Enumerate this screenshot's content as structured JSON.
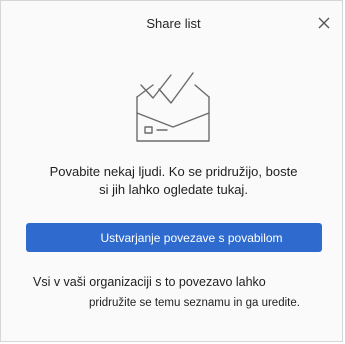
{
  "dialog": {
    "title": "Share list",
    "close_icon": "close-icon",
    "illustration_icon": "envelope-checkmark-icon",
    "message_line1": "Povabite nekaj ljudi. Ko se pridružijo, boste",
    "message_line2": "si jih lahko ogledate tukaj.",
    "primary_button_label": "Ustvarjanje povezave s povabilom",
    "info_line1": "Vsi v vaši organizaciji s to povezavo lahko",
    "info_line2": "pridružite se temu seznamu in ga uredite."
  },
  "colors": {
    "accent": "#2f6bcf",
    "background": "#fafafa",
    "icon_stroke": "#6b6b6b"
  }
}
